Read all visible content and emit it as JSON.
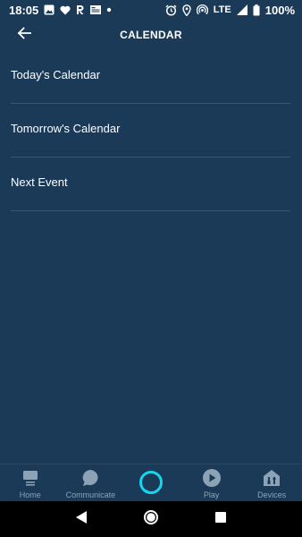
{
  "status_bar": {
    "time": "18:05",
    "network": "LTE",
    "battery": "100%"
  },
  "header": {
    "title": "CALENDAR"
  },
  "menu": {
    "items": [
      {
        "label": "Today's Calendar"
      },
      {
        "label": "Tomorrow's Calendar"
      },
      {
        "label": "Next Event"
      }
    ]
  },
  "bottom_nav": {
    "items": [
      {
        "label": "Home",
        "icon": "home-icon"
      },
      {
        "label": "Communicate",
        "icon": "chat-bubble-icon"
      },
      {
        "label": "",
        "icon": "alexa-icon"
      },
      {
        "label": "Play",
        "icon": "play-icon"
      },
      {
        "label": "Devices",
        "icon": "devices-icon"
      }
    ]
  },
  "colors": {
    "background": "#1b3a57",
    "accent": "#16d6ee",
    "nav_label": "#8ea2b5",
    "divider": "#3a5670"
  }
}
